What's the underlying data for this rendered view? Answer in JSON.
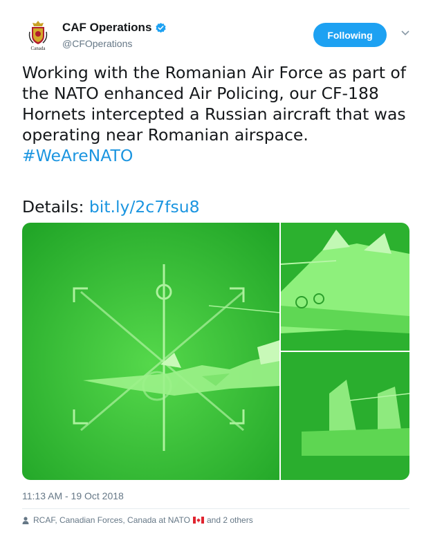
{
  "author": {
    "display_name": "CAF Operations",
    "handle": "@CFOperations",
    "avatar_caption": "Canada",
    "verified": true
  },
  "follow_button": {
    "label": "Following"
  },
  "menu_icon": "chevron-down-icon",
  "tweet": {
    "text": "Working with the Romanian Air Force as part of the NATO enhanced Air Policing, our CF-188 Hornets intercepted a Russian aircraft that was operating near Romanian airspace.",
    "hashtag": "#WeAreNATO",
    "details_label": "Details:",
    "details_link": "bit.ly/2c7fsu8"
  },
  "media": {
    "count": 3,
    "tint_color": "#3ec83a"
  },
  "timestamp": "11:13 AM - 19 Oct 2018",
  "tagged": {
    "prefix": "RCAF, Canadian Forces, Canada at NATO",
    "suffix": "and 2 others"
  },
  "colors": {
    "link": "#1b95e0",
    "button": "#1da1f2",
    "secondary_text": "#657786"
  }
}
